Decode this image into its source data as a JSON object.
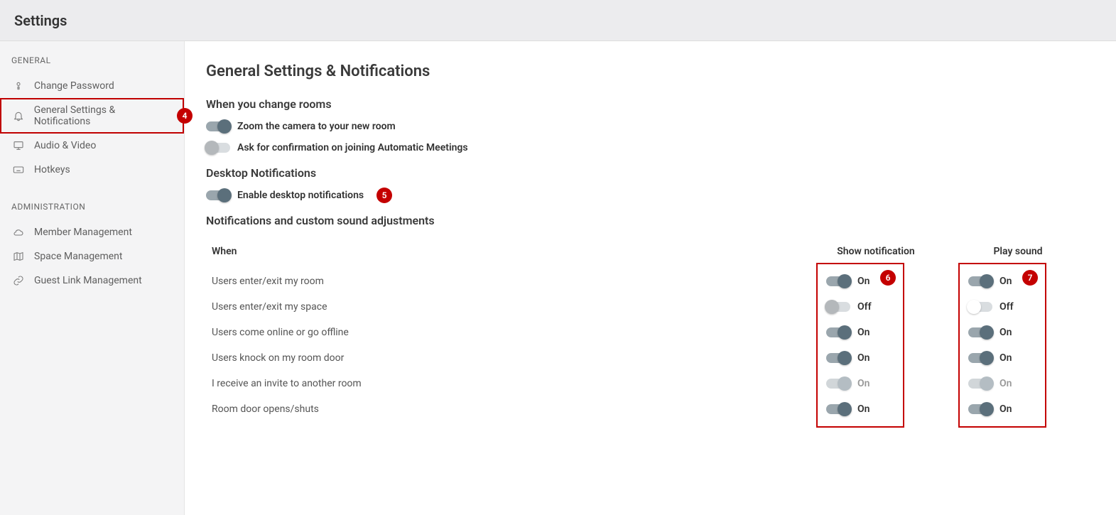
{
  "topbar": {
    "title": "Settings"
  },
  "sidebar": {
    "section_general": "GENERAL",
    "section_admin": "ADMINISTRATION",
    "items_general": [
      {
        "label": "Change Password",
        "icon": "password"
      },
      {
        "label": "General Settings & Notifications",
        "icon": "bell",
        "active": true
      },
      {
        "label": "Audio & Video",
        "icon": "monitor"
      },
      {
        "label": "Hotkeys",
        "icon": "keyboard"
      }
    ],
    "items_admin": [
      {
        "label": "Member Management",
        "icon": "cloud"
      },
      {
        "label": "Space Management",
        "icon": "map"
      },
      {
        "label": "Guest Link Management",
        "icon": "link"
      }
    ]
  },
  "main": {
    "heading": "General Settings & Notifications",
    "change_rooms": {
      "title": "When you change rooms",
      "zoom_label": "Zoom the camera to your new room",
      "zoom_on": true,
      "confirm_label": "Ask for confirmation on joining Automatic Meetings",
      "confirm_on": false
    },
    "desktop": {
      "title": "Desktop Notifications",
      "enable_label": "Enable desktop notifications",
      "enable_on": true
    },
    "notif_table": {
      "title": "Notifications and custom sound adjustments",
      "col_when": "When",
      "col_notif": "Show notification",
      "col_sound": "Play sound",
      "on_label": "On",
      "off_label": "Off",
      "rows": [
        {
          "when": "Users enter/exit my room",
          "notif": "on",
          "sound": "on"
        },
        {
          "when": "Users enter/exit my space",
          "notif": "off",
          "sound": "offwhite"
        },
        {
          "when": "Users come online or go offline",
          "notif": "on",
          "sound": "on"
        },
        {
          "when": "Users knock on my room door",
          "notif": "on",
          "sound": "on"
        },
        {
          "when": "I receive an invite to another room",
          "notif": "on_disabled",
          "sound": "on_disabled"
        },
        {
          "when": "Room door opens/shuts",
          "notif": "on",
          "sound": "on"
        }
      ]
    }
  },
  "callouts": {
    "b4": "4",
    "b5": "5",
    "b6": "6",
    "b7": "7"
  }
}
